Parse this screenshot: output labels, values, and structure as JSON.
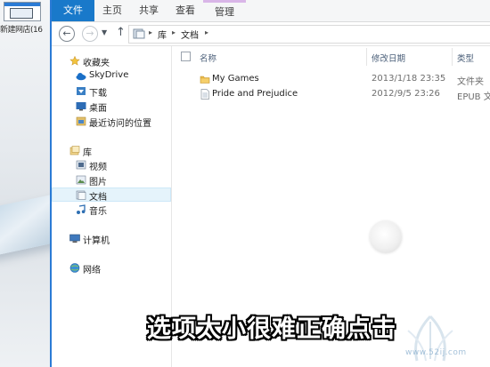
{
  "desktop": {
    "icon_label": "新建网店(16"
  },
  "ribbon": {
    "tabs": [
      "文件",
      "主页",
      "共享",
      "查看",
      "管理"
    ]
  },
  "address": {
    "crumbs": [
      "库",
      "文档"
    ]
  },
  "navpane": {
    "favorites": {
      "label": "收藏夹",
      "items": [
        "SkyDrive",
        "下载",
        "桌面",
        "最近访问的位置"
      ]
    },
    "libraries": {
      "label": "库",
      "items": [
        "视频",
        "图片",
        "文档",
        "音乐"
      ],
      "selected": "文档"
    },
    "computer": "计算机",
    "network": "网络"
  },
  "content": {
    "columns": {
      "name": "名称",
      "modified": "修改日期",
      "type": "类型"
    },
    "files": [
      {
        "name": "My Games",
        "modified": "2013/1/18 23:35",
        "type": "文件夹",
        "icon": "folder-icon"
      },
      {
        "name": "Pride and Prejudice",
        "modified": "2012/9/5 23:26",
        "type": "EPUB 文件",
        "icon": "epub-file-icon"
      }
    ]
  },
  "caption": "选项太小很难正确点击",
  "watermark": {
    "text": "www.52ij.com"
  },
  "colors": {
    "accent": "#1979ca",
    "selection": "#e5f3fb",
    "folder": "#e8b84a"
  }
}
